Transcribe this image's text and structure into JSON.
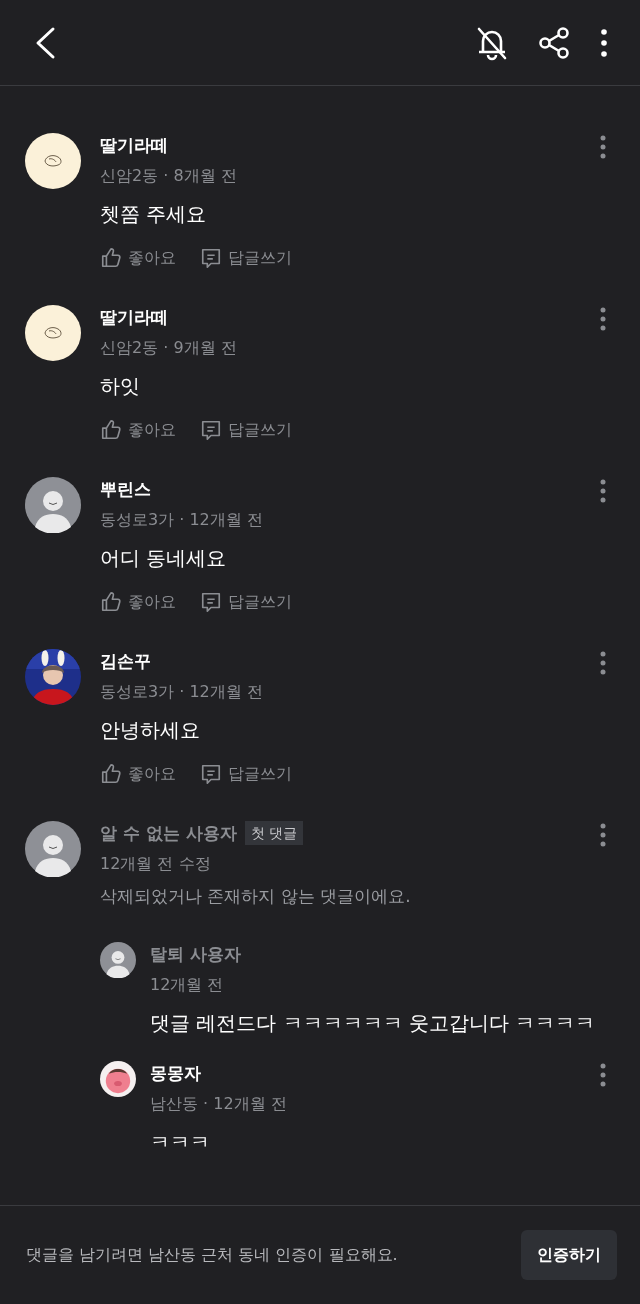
{
  "comments": [
    {
      "author": "딸기라떼",
      "avatar": {
        "kind": "sketch"
      },
      "meta": "신암2동 · 8개월 전",
      "body": "쳇쫌 주세요",
      "deleted": false,
      "more": true,
      "actions": [
        "좋아요",
        "답글쓰기"
      ]
    },
    {
      "author": "딸기라떼",
      "avatar": {
        "kind": "sketch"
      },
      "meta": "신암2동 · 9개월 전",
      "body": "하잇",
      "deleted": false,
      "more": true,
      "actions": [
        "좋아요",
        "답글쓰기"
      ]
    },
    {
      "author": "뿌린스",
      "avatar": {
        "kind": "default"
      },
      "meta": "동성로3가 · 12개월 전",
      "body": "어디 동네세요",
      "deleted": false,
      "more": true,
      "actions": [
        "좋아요",
        "답글쓰기"
      ]
    },
    {
      "author": "김손꾸",
      "meta": "동성로3가 · 12개월 전",
      "body": "안녕하세요",
      "deleted": false,
      "more": true,
      "actions": [
        "좋아요",
        "답글쓰기"
      ]
    },
    {
      "author": "알 수 없는 사용자",
      "badge": "첫 댓글",
      "avatar": {
        "kind": "default"
      },
      "meta": "12개월 전 수정",
      "body": "삭제되었거나 존재하지 않는 댓글이에요.",
      "deleted": true,
      "more": true,
      "children": [
        {
          "author": "탈퇴 사용자",
          "avatar": {
            "kind": "default"
          },
          "meta": "12개월 전",
          "body": "댓글 레전드다 ㅋㅋㅋㅋㅋㅋ 웃고갑니다 ㅋㅋㅋㅋ",
          "deleted": true,
          "more": false
        },
        {
          "author": "몽몽자",
          "avatar": {
            "kind": "pink"
          },
          "meta": "남산동 · 12개월 전",
          "body": "ㅋㅋㅋ",
          "deleted": false,
          "more": true
        }
      ]
    }
  ],
  "footer": {
    "notice": "댓글을 남기려면 남산동 근처 동네 인증이 필요해요.",
    "button": "인증하기"
  }
}
